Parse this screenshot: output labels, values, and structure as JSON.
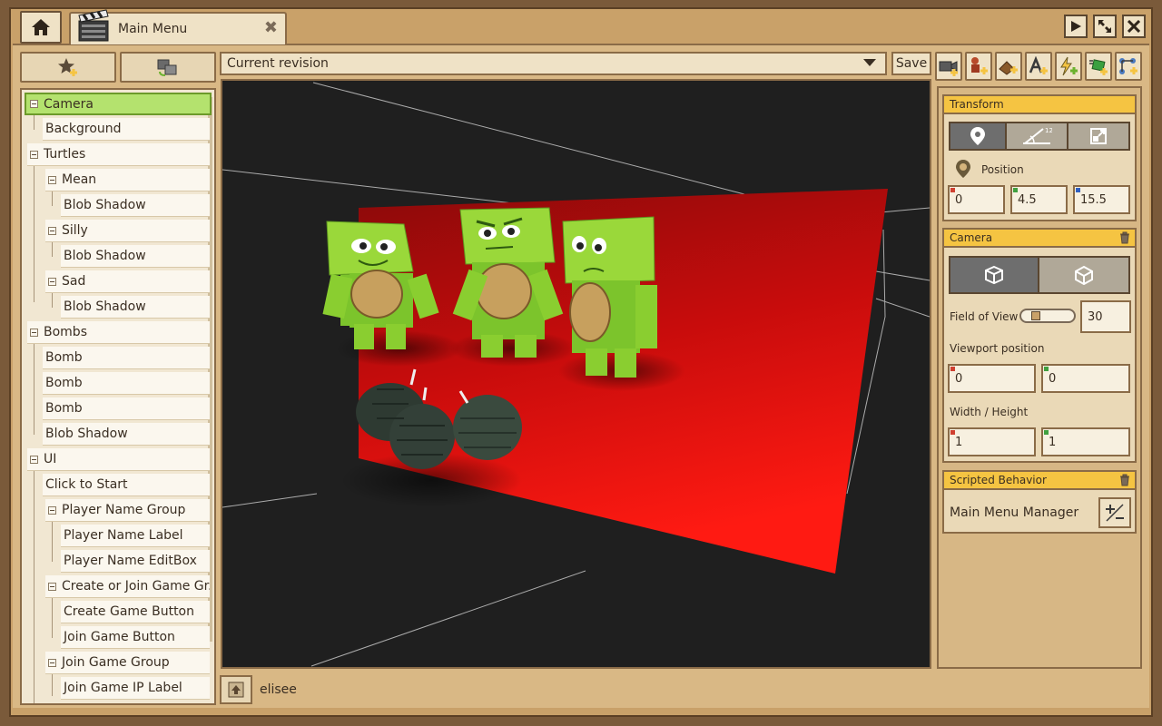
{
  "window": {
    "tab_title": "Main Menu",
    "tab_close": "✖"
  },
  "revision": {
    "selected": "Current revision",
    "save_label": "Save"
  },
  "tree": [
    {
      "label": "Camera",
      "selected": true
    },
    {
      "label": "Background"
    },
    {
      "label": "Turtles"
    },
    {
      "label": "Mean"
    },
    {
      "label": "Blob Shadow"
    },
    {
      "label": "Silly"
    },
    {
      "label": "Blob Shadow"
    },
    {
      "label": "Sad"
    },
    {
      "label": "Blob Shadow"
    },
    {
      "label": "Bombs"
    },
    {
      "label": "Bomb"
    },
    {
      "label": "Bomb"
    },
    {
      "label": "Bomb"
    },
    {
      "label": "Blob Shadow"
    },
    {
      "label": "UI"
    },
    {
      "label": "Click to Start"
    },
    {
      "label": "Player Name Group"
    },
    {
      "label": "Player Name Label"
    },
    {
      "label": "Player Name EditBox"
    },
    {
      "label": "Create or Join Game Gr..."
    },
    {
      "label": "Create Game Button"
    },
    {
      "label": "Join Game Button"
    },
    {
      "label": "Join Game Group"
    },
    {
      "label": "Join Game IP Label"
    }
  ],
  "status": {
    "user": "elisee"
  },
  "inspector": {
    "transform": {
      "title": "Transform",
      "position_label": "Position",
      "x": "0",
      "y": "4.5",
      "z": "15.5"
    },
    "camera": {
      "title": "Camera",
      "fov_label": "Field of View",
      "fov_value": "30",
      "fov_level": 0.2,
      "viewport_label": "Viewport position",
      "viewport_x": "0",
      "viewport_y": "0",
      "size_label": "Width / Height",
      "width": "1",
      "height": "1"
    },
    "behavior": {
      "title": "Scripted Behavior",
      "name": "Main Menu Manager"
    }
  },
  "colors": {
    "accent_selected": "#b4e26e",
    "section_header": "#f5c442",
    "axis_x": "#d04030",
    "axis_y": "#40a040",
    "axis_z": "#3060c0",
    "plane_red": "#e01010"
  }
}
